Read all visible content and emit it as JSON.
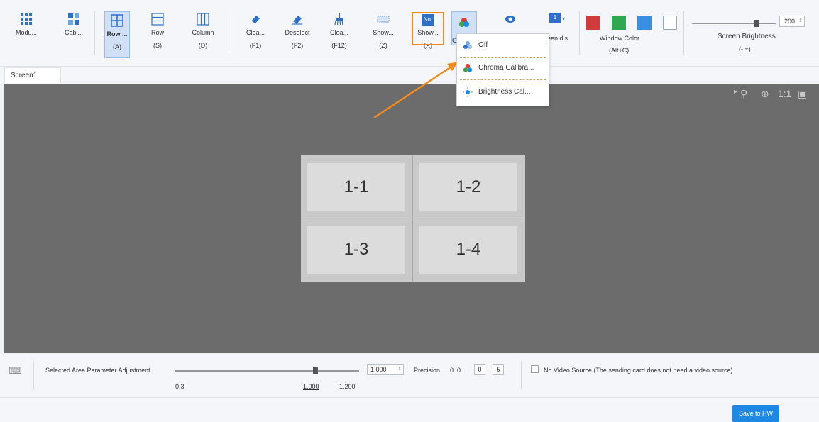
{
  "toolbar": {
    "buttons": [
      {
        "name": "modu",
        "l1": "Modu...",
        "l2": ""
      },
      {
        "name": "cabi",
        "l1": "Cabi...",
        "l2": ""
      },
      {
        "name": "row-a",
        "l1": "Row ...",
        "l2": "(A)"
      },
      {
        "name": "row-s",
        "l1": "Row",
        "l2": "(S)"
      },
      {
        "name": "column",
        "l1": "Column",
        "l2": "(D)"
      },
      {
        "name": "clea-f1",
        "l1": "Clea...",
        "l2": "(F1)"
      },
      {
        "name": "deselect",
        "l1": "Deselect",
        "l2": "(F2)"
      },
      {
        "name": "clea-f12",
        "l1": "Clea...",
        "l2": "(F12)"
      },
      {
        "name": "show-z",
        "l1": "Show...",
        "l2": "(Z)"
      },
      {
        "name": "show-x",
        "l1": "Show...",
        "l2": "(X)"
      }
    ],
    "show_x_badge": "No.",
    "color_btn_partial": "C",
    "screen_dis_label": "een dis",
    "screen_num_badge": "1",
    "window_color_label": "Window Color",
    "window_color_shortcut": "(Alt+C)",
    "window_colors": [
      "#d23b3b",
      "#2fa84f",
      "#3b8fe0",
      "#ffffff"
    ],
    "screen_brightness_label": "Screen Brightness",
    "screen_brightness_shortcut": "(-  +)",
    "screen_brightness_value": "200"
  },
  "dropdown": {
    "items": [
      {
        "label": "Off"
      },
      {
        "label": "Chroma Calibra..."
      },
      {
        "label": "Brightness Cal..."
      }
    ]
  },
  "tabs": [
    {
      "label": "Screen1"
    }
  ],
  "zoom_controls": {
    "label_1to1": "1:1"
  },
  "cells": [
    "1-1",
    "1-2",
    "1-3",
    "1-4"
  ],
  "bottom": {
    "param_label": "Selected Area Parameter Adjustment",
    "slider_min": "0.3",
    "slider_current": "1.000",
    "slider_max": "1.200",
    "slider_value": "1.000",
    "precision_label": "Precision",
    "precision_prefix": "0. 0",
    "precision_digit1": "0",
    "precision_digit2": "5",
    "no_video_label": "No Video Source (The sending card does not need a video source)",
    "save_label": "Save to HW"
  },
  "colors": {
    "accent": "#1e88e5",
    "highlight": "#f08c1e",
    "canvas": "#6c6c6c"
  }
}
